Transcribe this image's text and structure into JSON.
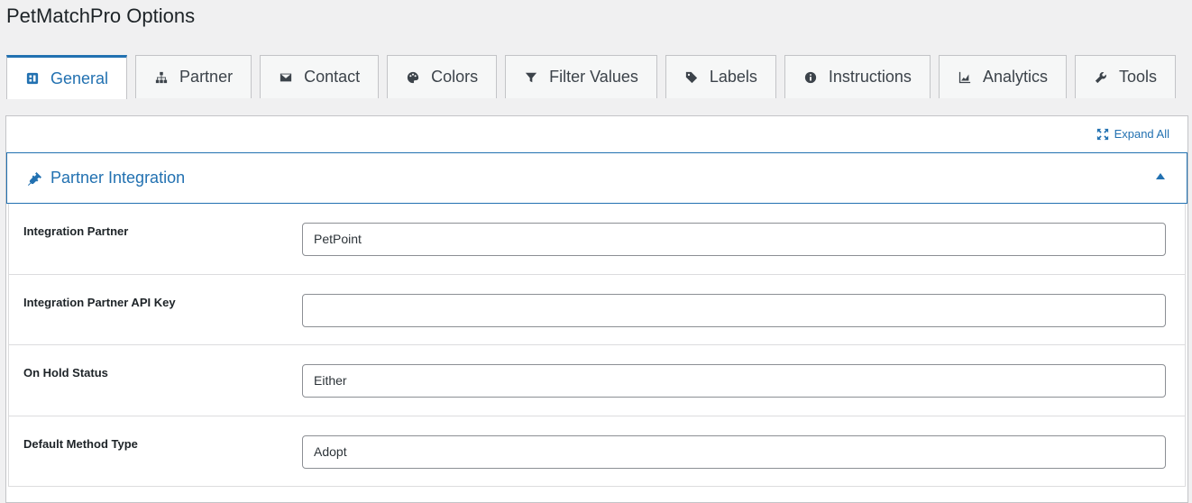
{
  "page": {
    "title": "PetMatchPro Options"
  },
  "tabs": [
    {
      "label": "General",
      "icon": "general-icon",
      "active": true
    },
    {
      "label": "Partner",
      "icon": "sitemap-icon",
      "active": false
    },
    {
      "label": "Contact",
      "icon": "envelope-icon",
      "active": false
    },
    {
      "label": "Colors",
      "icon": "palette-icon",
      "active": false
    },
    {
      "label": "Filter Values",
      "icon": "filter-icon",
      "active": false
    },
    {
      "label": "Labels",
      "icon": "tag-icon",
      "active": false
    },
    {
      "label": "Instructions",
      "icon": "info-icon",
      "active": false
    },
    {
      "label": "Analytics",
      "icon": "chart-icon",
      "active": false
    },
    {
      "label": "Tools",
      "icon": "wrench-icon",
      "active": false
    }
  ],
  "panel": {
    "expand_all_label": "Expand All",
    "section_title": "Partner Integration",
    "fields": [
      {
        "label": "Integration Partner",
        "value": "PetPoint"
      },
      {
        "label": "Integration Partner API Key",
        "value": ""
      },
      {
        "label": "On Hold Status",
        "value": "Either"
      },
      {
        "label": "Default Method Type",
        "value": "Adopt"
      }
    ]
  },
  "colors": {
    "accent": "#2271b1",
    "background": "#f0f0f1",
    "border": "#c3c4c7"
  }
}
